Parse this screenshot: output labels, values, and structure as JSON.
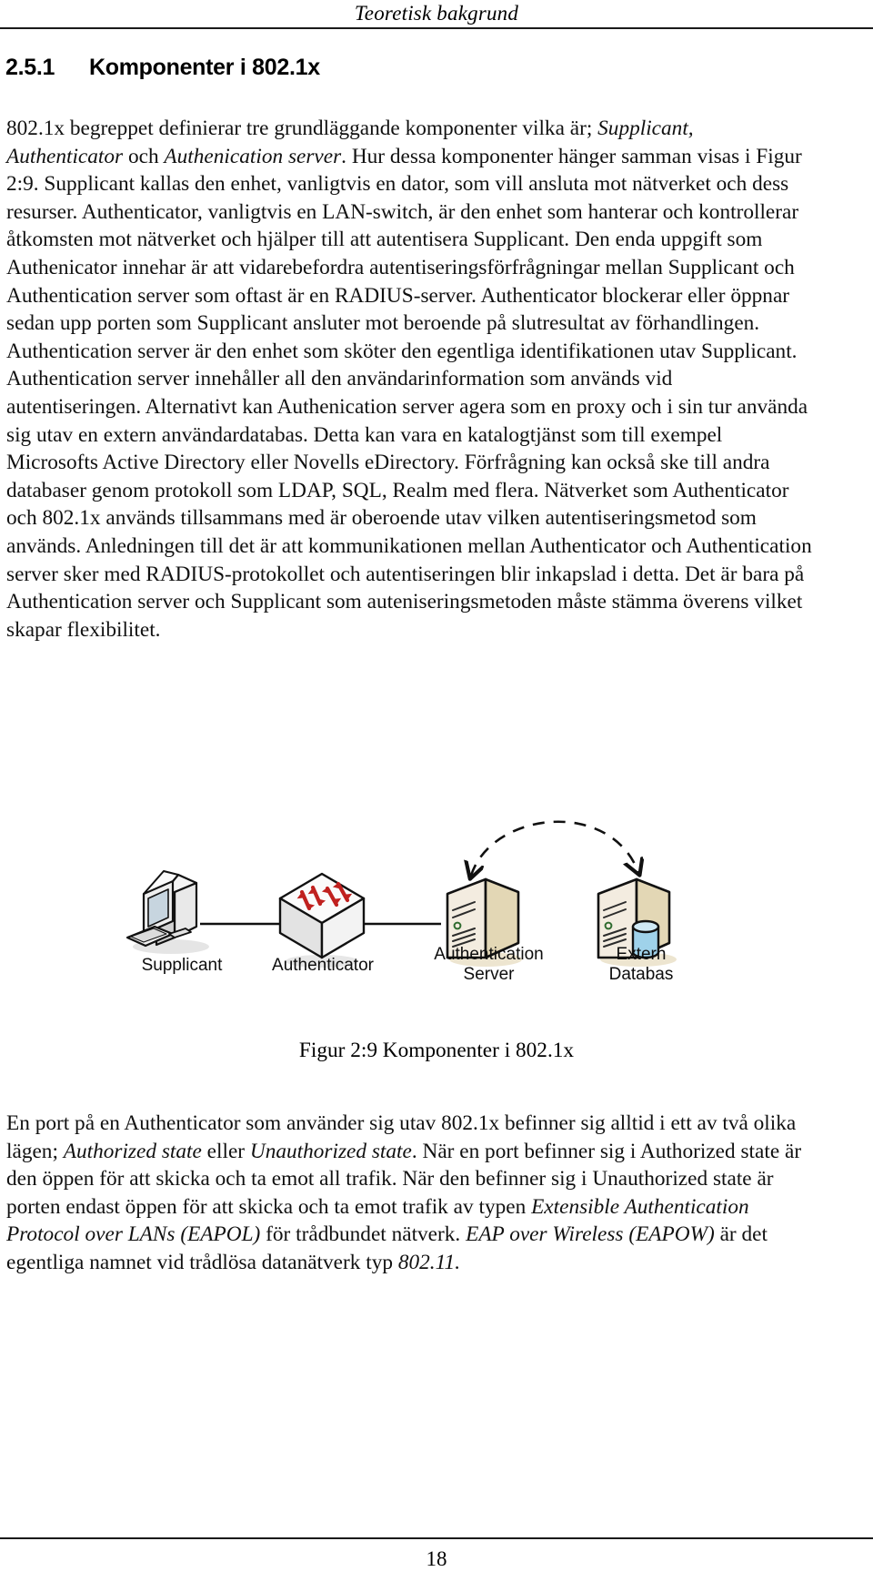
{
  "header": {
    "running_title": "Teoretisk bakgrund"
  },
  "heading": {
    "number": "2.5.1",
    "title": "Komponenter i 802.1x"
  },
  "paragraphs": {
    "p1": [
      {
        "t": "802.1x begreppet definierar tre grundläggande komponenter vilka är; ",
        "i": false
      },
      {
        "t": "Supplicant, Authenticator",
        "i": true
      },
      {
        "t": " och ",
        "i": false
      },
      {
        "t": "Authenication server",
        "i": true
      },
      {
        "t": ". Hur dessa komponenter hänger samman visas i Figur 2:9. Supplicant kallas den enhet, vanligtvis en dator, som vill ansluta mot nätverket och dess resurser. Authenticator, vanligtvis en LAN-switch, är den enhet som hanterar och kontrollerar åtkomsten mot nätverket och hjälper till att autentisera Supplicant. Den enda uppgift som Authenicator innehar är att vidarebefordra autentiseringsförfrågningar mellan Supplicant och Authentication server som oftast är en RADIUS-server. Authenticator blockerar eller öppnar sedan upp porten som Supplicant ansluter mot beroende på slutresultat av förhandlingen. Authentication server är den enhet som sköter den egentliga identifikationen utav Supplicant. Authentication server innehåller all den användarinformation som används vid autentiseringen. Alternativt kan Authenication server agera som en proxy och i sin tur använda sig utav en extern användardatabas. Detta kan vara en katalogtjänst som till exempel Microsofts Active Directory eller Novells eDirectory. Förfrågning kan också ske till andra databaser genom protokoll som LDAP, SQL, Realm med flera. Nätverket som Authenticator och 802.1x används tillsammans med är oberoende utav vilken autentiseringsmetod som används. Anledningen till det är att kommunikationen mellan Authenticator och Authentication server sker med RADIUS-protokollet och autentiseringen blir inkapslad i detta. Det är bara på Authentication server och Supplicant som auteniseringsmetoden måste stämma överens vilket skapar flexibilitet.",
        "i": false
      }
    ],
    "p2": [
      {
        "t": "En port på en Authenticator som använder sig utav 802.1x befinner sig alltid i ett av två olika lägen; ",
        "i": false
      },
      {
        "t": "Authorized state",
        "i": true
      },
      {
        "t": " eller ",
        "i": false
      },
      {
        "t": "Unauthorized state",
        "i": true
      },
      {
        "t": ". När en port befinner sig i Authorized state är den öppen för att skicka och ta emot all trafik. När den befinner sig i Unauthorized state är porten endast öppen för att skicka och ta emot trafik av typen ",
        "i": false
      },
      {
        "t": "Extensible Authentication Protocol over LANs (EAPOL)",
        "i": true
      },
      {
        "t": " för trådbundet nätverk. ",
        "i": false
      },
      {
        "t": "EAP over Wireless (EAPOW)",
        "i": true
      },
      {
        "t": " är det egentliga namnet vid trådlösa datanätverk typ ",
        "i": false
      },
      {
        "t": "802.11.",
        "i": true
      }
    ]
  },
  "figure": {
    "caption": "Figur 2:9 Komponenter i 802.1x",
    "nodes": [
      {
        "id": "supplicant",
        "label": "Supplicant",
        "icon": "desktop-computer-icon"
      },
      {
        "id": "authenticator",
        "label": "Authenticator",
        "icon": "network-switch-icon"
      },
      {
        "id": "auth-server",
        "label": "Authentication\nServer",
        "icon": "server-icon"
      },
      {
        "id": "extern-db",
        "label": "Extern\nDatabas",
        "icon": "server-database-icon"
      }
    ],
    "colors": {
      "server_front": "#efe7cf",
      "server_side": "#ded0aa",
      "switch_face": "#f2f2f2",
      "switch_arrow": "#c0211f",
      "database_cylinder": "#9fd2ea",
      "line": "#111111",
      "dashed_arc": "#111111"
    }
  },
  "footer": {
    "page_number": "18"
  }
}
